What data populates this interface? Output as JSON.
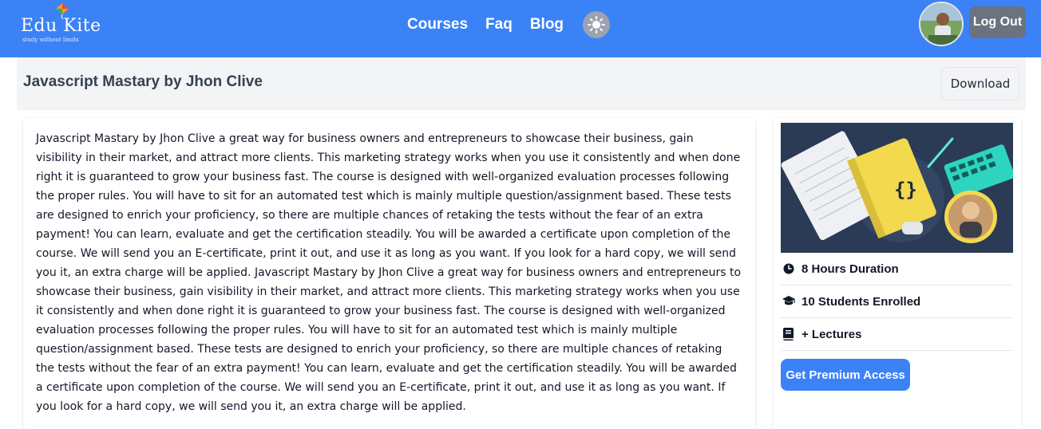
{
  "navbar": {
    "brand": "Edu Kite",
    "tagline": "study without limits",
    "links": [
      {
        "label": "Courses"
      },
      {
        "label": "Faq"
      },
      {
        "label": "Blog"
      }
    ],
    "logout_label": "Log Out",
    "colors": {
      "primary": "#3b82f6",
      "logout": "#6b7280",
      "toggle": "#9ca3af"
    }
  },
  "course": {
    "title": "Javascript Mastary by Jhon Clive",
    "download_label": "Download",
    "description": "Javascript Mastary by Jhon Clive a great way for business owners and entrepreneurs to showcase their business, gain visibility in their market, and attract more clients. This marketing strategy works when you use it consistently and when done right it is guaranteed to grow your business fast. The course is designed with well-organized evaluation processes following the proper rules. You will have to sit for an automated test which is mainly multiple question/assignment based. These tests are designed to enrich your proficiency, so there are multiple chances of retaking the tests without the fear of an extra payment! You can learn, evaluate and get the certification steadily. You will be awarded a certificate upon completion of the course. We will send you an E-certificate, print it out, and use it as long as you want. If you look for a hard copy, we will send you it, an extra charge will be applied. Javascript Mastary by Jhon Clive a great way for business owners and entrepreneurs to showcase their business, gain visibility in their market, and attract more clients. This marketing strategy works when you use it consistently and when done right it is guaranteed to grow your business fast. The course is designed with well-organized evaluation processes following the proper rules. You will have to sit for an automated test which is mainly multiple question/assignment based. These tests are designed to enrich your proficiency, so there are multiple chances of retaking the tests without the fear of an extra payment! You can learn, evaluate and get the certification steadily. You will be awarded a certificate upon completion of the course. We will send you an E-certificate, print it out, and use it as long as you want. If you look for a hard copy, we will send you it, an extra charge will be applied."
  },
  "sidebar": {
    "image_code_glyph": "{}",
    "duration": "8 Hours Duration",
    "students": "10 Students Enrolled",
    "lectures": "+ Lectures",
    "premium_label": "Get Premium Access"
  }
}
